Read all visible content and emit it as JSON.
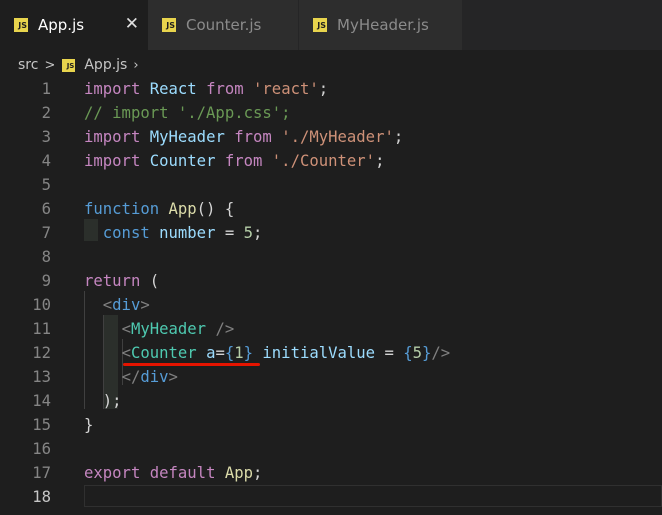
{
  "tabs": [
    {
      "label": "App.js",
      "active": true,
      "icon": "js-file-icon",
      "close": "✕"
    },
    {
      "label": "Counter.js",
      "active": false,
      "icon": "js-file-icon"
    },
    {
      "label": "MyHeader.js",
      "active": false,
      "icon": "js-file-icon"
    }
  ],
  "icon_text": "JS",
  "breadcrumb": {
    "folder": "src",
    "file": "App.js",
    "sep": ">",
    "trail": "›"
  },
  "lines": [
    {
      "num": "1"
    },
    {
      "num": "2"
    },
    {
      "num": "3"
    },
    {
      "num": "4"
    },
    {
      "num": "5"
    },
    {
      "num": "6"
    },
    {
      "num": "7"
    },
    {
      "num": "8"
    },
    {
      "num": "9"
    },
    {
      "num": "10"
    },
    {
      "num": "11"
    },
    {
      "num": "12"
    },
    {
      "num": "13"
    },
    {
      "num": "14"
    },
    {
      "num": "15"
    },
    {
      "num": "16"
    },
    {
      "num": "17"
    },
    {
      "num": "18"
    }
  ],
  "tokens": {
    "l1": [
      "import",
      " ",
      "React",
      " ",
      "from",
      " ",
      "'react'",
      ";"
    ],
    "l2": [
      "// import './App.css';"
    ],
    "l3": [
      "import",
      " ",
      "MyHeader",
      " ",
      "from",
      " ",
      "'./MyHeader'",
      ";"
    ],
    "l4": [
      "import",
      " ",
      "Counter",
      " ",
      "from",
      " ",
      "'./Counter'",
      ";"
    ],
    "l6": [
      "function",
      " ",
      "App",
      "()",
      " ",
      "{"
    ],
    "l7": [
      "  ",
      "const",
      " ",
      "number",
      " = ",
      "5",
      ";"
    ],
    "l9": [
      "return",
      " ("
    ],
    "l10": [
      "  ",
      "<",
      "div",
      ">"
    ],
    "l11": [
      "    ",
      "<",
      "MyHeader",
      " ",
      "/>"
    ],
    "l12": [
      "    ",
      "<",
      "Counter",
      " ",
      "a",
      "=",
      "{",
      "1",
      "}",
      " ",
      "initialValue",
      " = ",
      "{",
      "5",
      "}",
      "/>"
    ],
    "l13": [
      "    ",
      "</",
      "div",
      ">"
    ],
    "l14": [
      "  ",
      ");"
    ],
    "l15": [
      "}"
    ],
    "l17": [
      "export",
      " ",
      "default",
      " ",
      "App",
      ";"
    ]
  },
  "colors": {
    "error_squiggle": "#e51400",
    "keyword": "#569cd6",
    "control": "#c586c0",
    "string": "#ce9178",
    "comment": "#6a9955"
  }
}
